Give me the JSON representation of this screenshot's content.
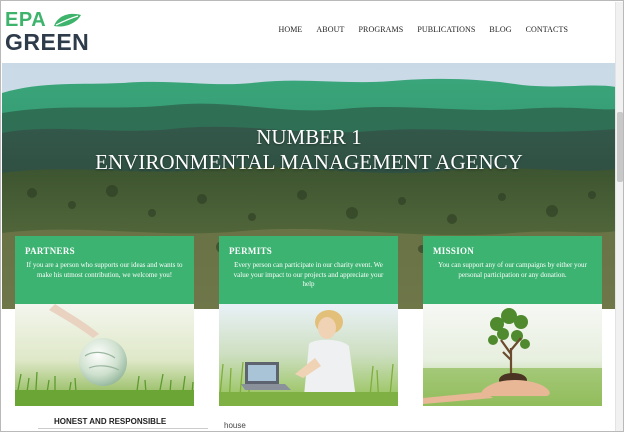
{
  "header": {
    "logo_top": "EPA",
    "logo_bottom": "GREEN",
    "nav": [
      "HOME",
      "ABOUT",
      "PROGRAMS",
      "PUBLICATIONS",
      "BLOG",
      "CONTACTS"
    ]
  },
  "hero": {
    "title_line1": "NUMBER 1",
    "title_line2": "ENVIRONMENTAL MANAGEMENT AGENCY"
  },
  "cards": [
    {
      "title": "PARTNERS",
      "text": "If you are a person who supports our ideas and wants to make his utmost contribution, we welcome you!",
      "image": "glass-globe-in-grass"
    },
    {
      "title": "PERMITS",
      "text": "Every person can participate in our charity event. We value your impact to our projects and appreciate your help",
      "image": "woman-with-laptop-in-field"
    },
    {
      "title": "MISSION",
      "text": "You can support any of our campaigns by either your personal participation or any donation.",
      "image": "hand-holding-tree-sapling"
    }
  ],
  "footer": {
    "left": "HONEST AND RESPONSIBLE",
    "mid": "house"
  },
  "colors": {
    "accent": "#3cb371",
    "logo_dark": "#2e3b4a"
  }
}
